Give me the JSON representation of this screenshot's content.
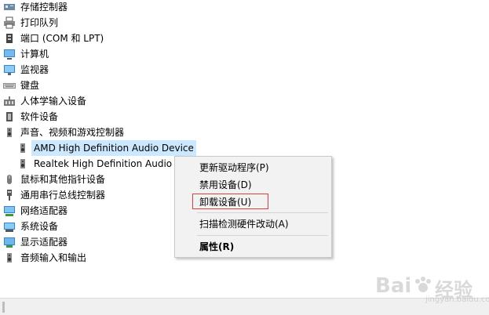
{
  "tree": {
    "items": [
      {
        "label": "存储控制器",
        "icon": "storage-controller-icon"
      },
      {
        "label": "打印队列",
        "icon": "printer-icon"
      },
      {
        "label": "端口 (COM 和 LPT)",
        "icon": "port-icon"
      },
      {
        "label": "计算机",
        "icon": "computer-icon"
      },
      {
        "label": "监视器",
        "icon": "monitor-icon"
      },
      {
        "label": "键盘",
        "icon": "keyboard-icon"
      },
      {
        "label": "人体学输入设备",
        "icon": "hid-icon"
      },
      {
        "label": "软件设备",
        "icon": "software-device-icon"
      },
      {
        "label": "声音、视频和游戏控制器",
        "icon": "speaker-icon"
      },
      {
        "label": "AMD High Definition Audio Device",
        "icon": "speaker-icon"
      },
      {
        "label": "Realtek High Definition Audio",
        "icon": "speaker-icon"
      },
      {
        "label": "鼠标和其他指针设备",
        "icon": "mouse-icon"
      },
      {
        "label": "通用串行总线控制器",
        "icon": "usb-icon"
      },
      {
        "label": "网络适配器",
        "icon": "network-adapter-icon"
      },
      {
        "label": "系统设备",
        "icon": "system-device-icon"
      },
      {
        "label": "显示适配器",
        "icon": "display-adapter-icon"
      },
      {
        "label": "音频输入和输出",
        "icon": "speaker-icon"
      }
    ]
  },
  "context_menu": {
    "items": [
      {
        "label": "更新驱动程序(P)"
      },
      {
        "label": "禁用设备(D)"
      },
      {
        "label": "卸载设备(U)"
      },
      {
        "label": "扫描检测硬件改动(A)"
      },
      {
        "label": "属性(R)"
      }
    ]
  },
  "watermark": {
    "text": "Bai",
    "paw": "du",
    "sub": "jingyan.baidu.com",
    "chinese": "经验"
  },
  "colors": {
    "selection": "#cce8ff",
    "highlight_border": "#e23d3d",
    "menu_bg": "#f2f2f2"
  }
}
